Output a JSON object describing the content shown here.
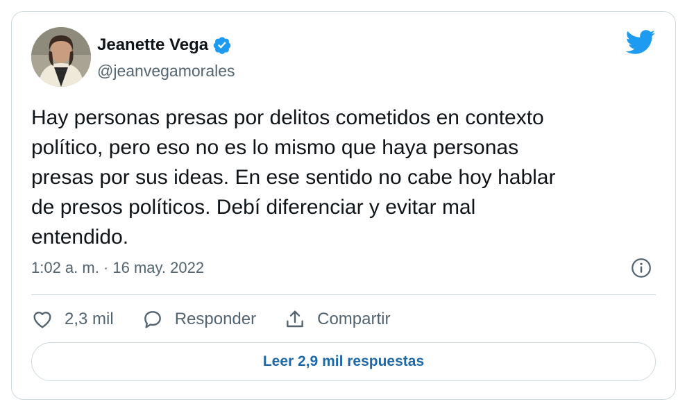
{
  "author": {
    "name": "Jeanette Vega",
    "handle": "@jeanvegamorales",
    "verified": true
  },
  "tweet": {
    "text": "Hay personas presas por delitos cometidos en contexto\npolítico, pero eso no es lo mismo que haya personas\npresas por sus ideas. En ese sentido no cabe hoy hablar\nde presos políticos. Debí diferenciar y evitar mal\nentendido.",
    "timestamp": "1:02 a. m. · 16 may. 2022"
  },
  "actions": {
    "like_count": "2,3 mil",
    "reply_label": "Responder",
    "share_label": "Compartir"
  },
  "replies_button": "Leer 2,9 mil respuestas",
  "icons": {
    "brand": "twitter-bird-icon",
    "verified": "verified-badge-icon",
    "info": "info-icon",
    "like": "heart-icon",
    "reply": "speech-bubble-icon",
    "share": "share-upload-icon"
  },
  "colors": {
    "brand_blue": "#1d9bf0",
    "secondary_text": "#536471",
    "link_text": "#1d68a8",
    "border": "#cfd9de"
  }
}
